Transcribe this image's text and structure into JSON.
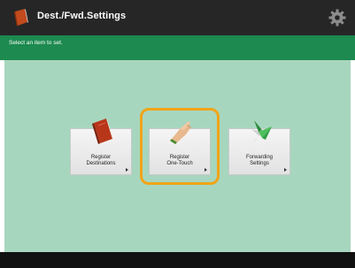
{
  "header": {
    "title": "Dest./Fwd.Settings",
    "title_icon": "book-icon",
    "settings_icon": "gear-icon"
  },
  "message": {
    "text": "Select an item to set."
  },
  "tiles": [
    {
      "label_line1": "Register",
      "label_line2": "Destinations",
      "icon": "address-book-icon"
    },
    {
      "label_line1": "Register",
      "label_line2": "One-Touch",
      "icon": "pointing-hand-icon"
    },
    {
      "label_line1": "Forwarding",
      "label_line2": "Settings",
      "icon": "forward-arrow-icon"
    }
  ],
  "colors": {
    "titlebar": "#262626",
    "message_bar": "#1d8a4f",
    "main_bg": "#a7d6be",
    "focus_ring": "#f0a418"
  }
}
